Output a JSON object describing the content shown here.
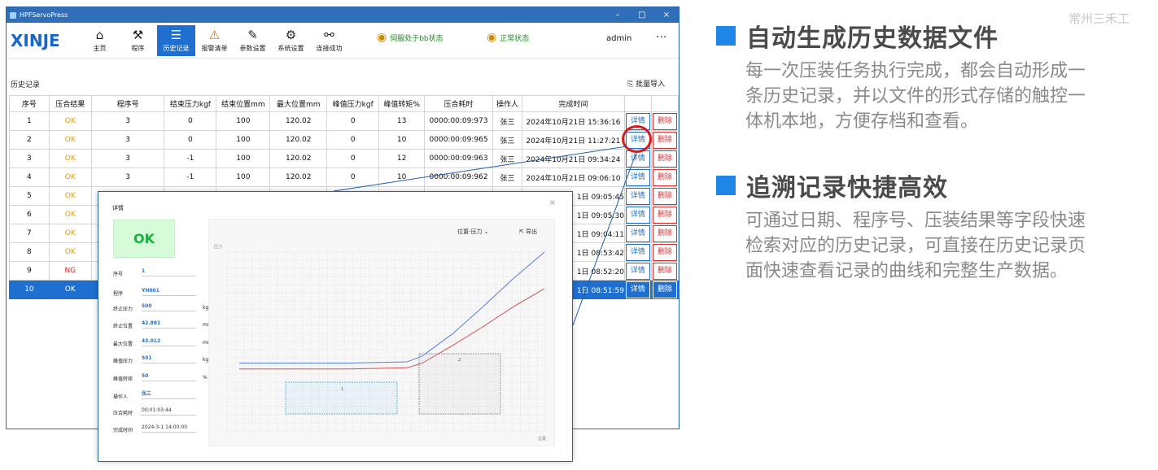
{
  "window": {
    "title": "HPFServoPress"
  },
  "toolbar": {
    "logo": "XINJE",
    "buttons": [
      {
        "label": "主页"
      },
      {
        "label": "程序"
      },
      {
        "label": "历史记录"
      },
      {
        "label": "报警清单"
      },
      {
        "label": "参数设置"
      },
      {
        "label": "系统设置"
      },
      {
        "label": "连接成功"
      }
    ],
    "status1": "伺服处于bb状态",
    "status2": "正常状态",
    "user": "admin",
    "more": "···"
  },
  "history": {
    "title": "历史记录",
    "import_label": "批量导入",
    "columns": [
      "序号",
      "压合结果",
      "程序号",
      "结束压力kgf",
      "结束位置mm",
      "最大位置mm",
      "峰值压力kgf",
      "峰值转矩%",
      "压合耗时",
      "操作人",
      "完成时间"
    ],
    "detail_label": "详情",
    "delete_label": "删除",
    "rows": [
      [
        "1",
        "OK",
        "3",
        "0",
        "100",
        "120.02",
        "0",
        "13",
        "0000:00:09:973",
        "张三",
        "2024年10月21日 15:36:16"
      ],
      [
        "2",
        "OK",
        "3",
        "0",
        "100",
        "120.02",
        "0",
        "10",
        "0000:00:09:965",
        "张三",
        "2024年10月21日 11:27:21"
      ],
      [
        "3",
        "OK",
        "3",
        "-1",
        "100",
        "120.02",
        "0",
        "12",
        "0000:00:09:963",
        "张三",
        "2024年10月21日 09:34:24"
      ],
      [
        "4",
        "OK",
        "3",
        "-1",
        "100",
        "120.02",
        "0",
        "10",
        "0000:00:09:962",
        "张三",
        "2024年10月21日 09:06:10"
      ],
      [
        "5",
        "OK",
        "",
        "",
        "",
        "",
        "",
        "",
        "",
        "",
        "1日 09:05:45"
      ],
      [
        "6",
        "OK",
        "",
        "",
        "",
        "",
        "",
        "",
        "",
        "",
        "1日 09:05:30"
      ],
      [
        "7",
        "OK",
        "",
        "",
        "",
        "",
        "",
        "",
        "",
        "",
        "1日 09:04:11"
      ],
      [
        "8",
        "OK",
        "",
        "",
        "",
        "",
        "",
        "",
        "",
        "",
        "1日 08:53:42"
      ],
      [
        "9",
        "NG",
        "",
        "",
        "",
        "",
        "",
        "",
        "",
        "",
        "1日 08:52:20"
      ],
      [
        "10",
        "OK",
        "",
        "",
        "",
        "",
        "",
        "",
        "",
        "",
        "1日 08:51:59"
      ]
    ]
  },
  "detail": {
    "title": "详情",
    "close": "×",
    "result": "OK",
    "fields": [
      {
        "label": "序号",
        "value": "1",
        "unit": ""
      },
      {
        "label": "程序",
        "value": "YH001",
        "unit": ""
      },
      {
        "label": "终止压力",
        "value": "500",
        "unit": "kgf"
      },
      {
        "label": "终止位置",
        "value": "42.881",
        "unit": "mm"
      },
      {
        "label": "最大位置",
        "value": "43.012",
        "unit": "mm"
      },
      {
        "label": "峰值压力",
        "value": "501",
        "unit": "kgf"
      },
      {
        "label": "峰值转矩",
        "value": "50",
        "unit": "%"
      },
      {
        "label": "操作人",
        "value": "张三",
        "unit": ""
      },
      {
        "label": "压合耗时",
        "value": "00:01:03:44",
        "unit": ""
      },
      {
        "label": "完成时间",
        "value": "2024-3-1  14:00:00",
        "unit": ""
      }
    ],
    "chart_select": "位置-压力",
    "export_label": "导出",
    "ylabel": "压力",
    "xlabel": "位置",
    "markers": [
      "1",
      "2"
    ]
  },
  "chart_data": {
    "type": "line",
    "xlabel": "位置",
    "ylabel": "压力",
    "series": [
      {
        "name": "",
        "x": [
          0,
          0.36,
          0.55,
          0.6,
          0.7,
          0.8,
          0.9,
          1.0
        ],
        "y": [
          0.3,
          0.3,
          0.31,
          0.36,
          0.55,
          0.78,
          1.02,
          1.24
        ]
      },
      {
        "name": "",
        "x": [
          0,
          0.36,
          0.55,
          0.6,
          0.7,
          0.8,
          0.9,
          1.0
        ],
        "y": [
          0.25,
          0.25,
          0.26,
          0.3,
          0.45,
          0.61,
          0.78,
          0.93
        ]
      }
    ]
  },
  "right": {
    "brand": "常州三禾工",
    "h1": "自动生成历史数据文件",
    "p1": [
      "每一次压装任务执行完成，都会自动形成一",
      "条历史记录，并以文件的形式存储的触控一",
      "体机本地，方便存档和查看。"
    ],
    "h2": "追溯记录快捷高效",
    "p2": [
      "可通过日期、程序号、压装结果等字段快速",
      "检索对应的历史记录，可直接在历史记录页",
      "面快速查看记录的曲线和完整生产数据。"
    ]
  }
}
